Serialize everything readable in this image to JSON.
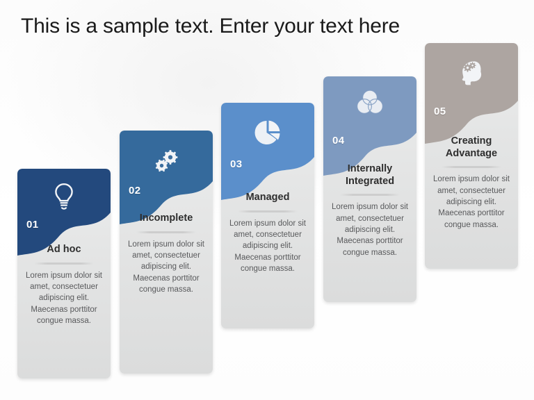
{
  "slide": {
    "title": "This is a sample text. Enter your text here",
    "background_color": "#ffffff"
  },
  "cards": [
    {
      "number": "01",
      "title": "Ad hoc",
      "description": "Lorem ipsum dolor sit amet, consectetuer adipiscing elit. Maecenas porttitor congue massa.",
      "icon": "lightbulb-icon",
      "color": "#23497d"
    },
    {
      "number": "02",
      "title": "Incomplete",
      "description": "Lorem ipsum dolor sit amet, consectetuer adipiscing elit. Maecenas porttitor congue massa.",
      "icon": "gears-icon",
      "color": "#356a9c"
    },
    {
      "number": "03",
      "title": "Managed",
      "description": "Lorem ipsum dolor sit amet, consectetuer adipiscing elit. Maecenas porttitor congue massa.",
      "icon": "pie-chart-icon",
      "color": "#5b8fcb"
    },
    {
      "number": "04",
      "title": "Internally Integrated",
      "description": "Lorem ipsum dolor sit amet, consectetuer adipiscing elit. Maecenas porttitor congue massa.",
      "icon": "venn-diagram-icon",
      "color": "#7e9ac0"
    },
    {
      "number": "05",
      "title": "Creating Advantage",
      "description": "Lorem ipsum dolor sit amet, consectetuer adipiscing elit. Maecenas porttitor congue massa.",
      "icon": "head-gears-icon",
      "color": "#ada5a1"
    }
  ]
}
